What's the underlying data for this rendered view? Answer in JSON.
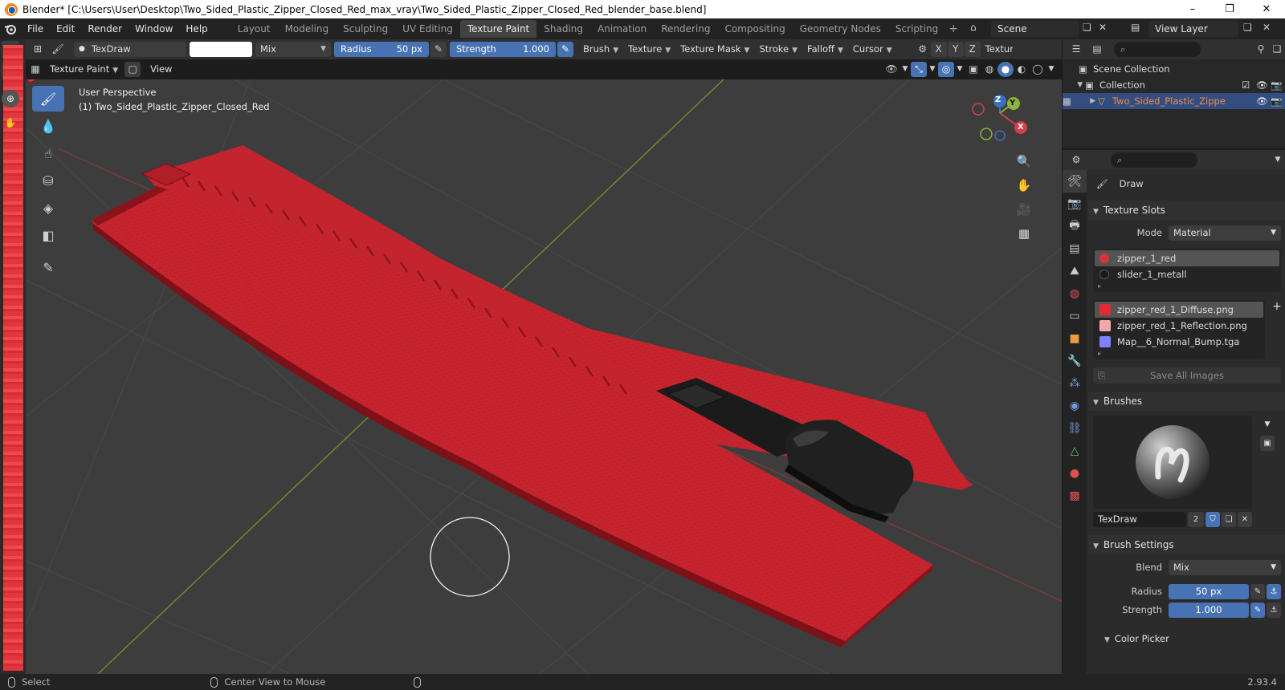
{
  "window": {
    "title": "Blender* [C:\\Users\\User\\Desktop\\Two_Sided_Plastic_Zipper_Closed_Red_max_vray\\Two_Sided_Plastic_Zipper_Closed_Red_blender_base.blend]",
    "minimize": "–",
    "maximize": "❐",
    "close": "✕"
  },
  "menu": {
    "items": [
      "File",
      "Edit",
      "Render",
      "Window",
      "Help"
    ],
    "workspaces": [
      "Layout",
      "Modeling",
      "Sculpting",
      "UV Editing",
      "Texture Paint",
      "Shading",
      "Animation",
      "Rendering",
      "Compositing",
      "Geometry Nodes",
      "Scripting"
    ],
    "active_workspace": "Texture Paint",
    "add_workspace": "+",
    "scene": "Scene",
    "view_layer": "View Layer"
  },
  "tool_header": {
    "brush_name": "TexDraw",
    "blend": "Mix",
    "radius_label": "Radius",
    "radius_value": "50 px",
    "strength_label": "Strength",
    "strength_value": "1.000",
    "menus": [
      "Brush",
      "Texture",
      "Texture Mask",
      "Stroke",
      "Falloff",
      "Cursor"
    ],
    "axes": [
      "X",
      "Y",
      "Z"
    ],
    "texture_trunc": "Texture"
  },
  "viewport_header": {
    "mode": "Texture Paint",
    "view": "View"
  },
  "viewport": {
    "perspective": "User Perspective",
    "object": "(1) Two_Sided_Plastic_Zipper_Closed_Red",
    "gizmo": {
      "z": "Z",
      "y": "Y",
      "x": "X"
    }
  },
  "outliner": {
    "scene_collection": "Scene Collection",
    "collection": "Collection",
    "object": "Two_Sided_Plastic_Zippe"
  },
  "properties": {
    "tool_name": "Draw",
    "texture_slots_title": "Texture Slots",
    "mode_label": "Mode",
    "mode_value": "Material",
    "materials": [
      {
        "name": "zipper_1_red",
        "color": "#d8333a"
      },
      {
        "name": "slider_1_metall",
        "color": "#1a1a1a"
      }
    ],
    "images": [
      {
        "name": "zipper_red_1_Diffuse.png",
        "color": "#e02b33"
      },
      {
        "name": "zipper_red_1_Reflection.png",
        "color": "#f2a9ad"
      },
      {
        "name": "Map__6_Normal_Bump.tga",
        "color": "#8080ff"
      }
    ],
    "save_all": "Save All Images",
    "brushes_title": "Brushes",
    "brush_name": "TexDraw",
    "brush_users": "2",
    "brush_settings_title": "Brush Settings",
    "blend_label": "Blend",
    "blend_value": "Mix",
    "radius_label": "Radius",
    "radius_value": "50 px",
    "strength_label": "Strength",
    "strength_value": "1.000",
    "color_picker_title": "Color Picker"
  },
  "statusbar": {
    "select": "Select",
    "center_view": "Center View to Mouse",
    "version": "2.93.4"
  },
  "colors": {
    "accent": "#4772b3",
    "zipper_red": "#c8222c",
    "slider_black": "#1b1b1b"
  }
}
